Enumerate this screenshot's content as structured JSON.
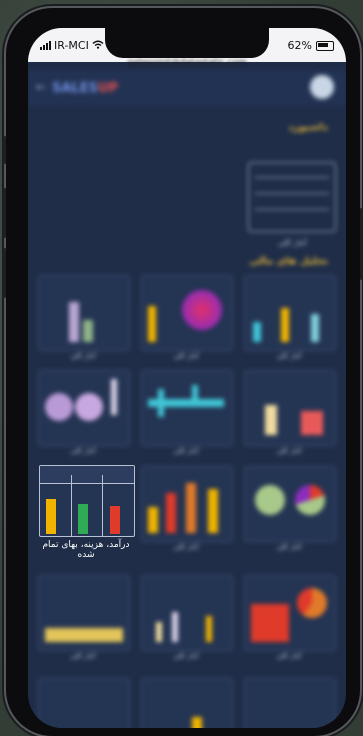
{
  "status_bar": {
    "carrier": "IR-MCI",
    "battery_percent": "62%"
  },
  "url_bar": {
    "url": "gatepoint@datastatic.com"
  },
  "app": {
    "logo_part1": "SALES",
    "logo_part2": "UP"
  },
  "sections": {
    "section1_title": "داشبورد",
    "section2_title": "تحلیل های مالی",
    "dashboard_caption": "آمار کلی"
  },
  "featured_card": {
    "caption": "درآمد، هزینه، بهای تمام شده",
    "bars": [
      {
        "value": 0.7,
        "color": "#f0b400"
      },
      {
        "value": 0.6,
        "color": "#2faa55"
      },
      {
        "value": 0.55,
        "color": "#e03a2a"
      }
    ]
  },
  "card_captions": [
    "آمار کلی",
    "آمار کلی",
    "آمار کلی",
    "آمار کلی",
    "آمار کلی",
    "آمار کلی",
    "آمار کلی",
    "آمار کلی",
    "آمار کلی",
    "آمار کلی",
    "آمار کلی",
    "آمار کلی"
  ],
  "colors": {
    "screen_bg": "#1f2d48",
    "card_border": "#3f5172",
    "accent_yellow": "#f0b400",
    "accent_red": "#e03a2a",
    "accent_green": "#2faa55",
    "accent_teal": "#3fc6d6",
    "accent_purple": "#8b2dbd"
  }
}
